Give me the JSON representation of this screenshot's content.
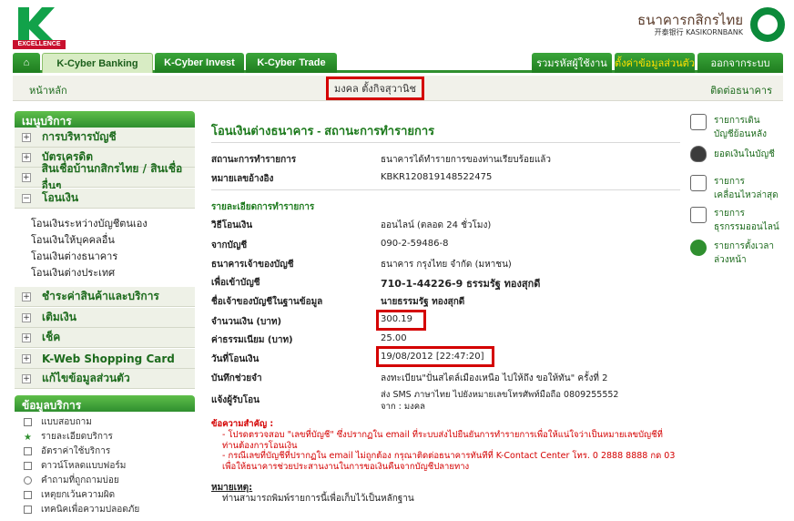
{
  "logo": {
    "brand_letter": "K",
    "excellence": "EXCELLENCE"
  },
  "bank_logo": {
    "thai": "ธนาคารกสิกรไทย",
    "english": "开泰银行 KASIKORNBANK"
  },
  "tabs": {
    "home": "⌂",
    "cyber_banking": "K-Cyber Banking",
    "cyber_invest": "K-Cyber Invest",
    "cyber_trade": "K-Cyber Trade",
    "change_password": "รวมรหัสผู้ใช้งาน",
    "personal_settings": "ตั้งค่าข้อมูลส่วนตัว",
    "logout": "ออกจากระบบ"
  },
  "subbar": {
    "home": "หน้าหลัก",
    "user": "มงคล ตั้งกิจสุวานิช",
    "contact": "ติดต่อธนาคาร"
  },
  "sidebar": {
    "menu_title": "เมนูบริการ",
    "items": [
      {
        "label": "การบริหารบัญชี",
        "toggle": "+"
      },
      {
        "label": "บัตรเครดิต",
        "toggle": "+"
      },
      {
        "label": "สินเชื่อบ้านกสิกรไทย / สินเชื่ออื่นๆ",
        "toggle": "+"
      },
      {
        "label": "โอนเงิน",
        "toggle": "−"
      },
      {
        "label": "ชำระค่าสินค้าและบริการ",
        "toggle": "+"
      },
      {
        "label": "เติมเงิน",
        "toggle": "+"
      },
      {
        "label": "เช็ค",
        "toggle": "+"
      },
      {
        "label": "K-Web Shopping Card",
        "toggle": "+"
      },
      {
        "label": "แก้ไขข้อมูลส่วนตัว",
        "toggle": "+"
      }
    ],
    "transfer_sub": [
      "โอนเงินระหว่างบัญชีตนเอง",
      "โอนเงินให้บุคคลอื่น",
      "โอนเงินต่างธนาคาร",
      "โอนเงินต่างประเทศ"
    ],
    "services_title": "ข้อมูลบริการ",
    "services": [
      "แบบสอบถาม",
      "รายละเอียดบริการ",
      "อัตราค่าใช้บริการ",
      "ดาวน์โหลดแบบฟอร์ม",
      "คำถามที่ถูกถามบ่อย",
      "เหตุยกเว้นความผิด",
      "เทคนิคเพื่อความปลอดภัย"
    ]
  },
  "main": {
    "title": "โอนเงินต่างธนาคาร - สถานะการทำรายการ",
    "status_label": "สถานะการทำรายการ",
    "status_value": "ธนาคารได้ทำรายการของท่านเรียบร้อยแล้ว",
    "ref_label": "หมายเลขอ้างอิง",
    "ref_value": "KBKR120819148522475",
    "details_title": "รายละเอียดการทำรายการ",
    "method_label": "วิธีโอนเงิน",
    "method_value": "ออนไลน์ (ตลอด 24 ชั่วโมง)",
    "from_label": "จากบัญชี",
    "from_value": "090-2-59486-8",
    "bank_label": "ธนาคารเจ้าของบัญชี",
    "bank_value": "ธนาคาร กรุงไทย จำกัด (มหาชน)",
    "to_label": "เพื่อเข้าบัญชี",
    "to_value": "710-1-44226-9 ธรรมรัฐ ทองสุกดี",
    "owner_label": "ชื่อเจ้าของบัญชีในฐานข้อมูล",
    "owner_value": "นายธรรมรัฐ ทองสุกดี",
    "amount_label": "จำนวนเงิน (บาท)",
    "amount_value": "300.19",
    "fee_label": "ค่าธรรมเนียม (บาท)",
    "fee_value": "25.00",
    "date_label": "วันที่โอนเงิน",
    "date_value": "19/08/2012 [22:47:20]",
    "memo_label": "บันทึกช่วยจำ",
    "memo_value": "ลงทะเบียน\"ปั่นสไตล์เมืองเหนือ ไปให้ถึง ขอให้ทัน\" ครั้งที่ 2",
    "notify_label": "แจ้งผู้รับโอน",
    "notify_value": "ส่ง SMS ภาษาไทย ไปยังหมายเลขโทรศัพท์มือถือ 0809255552",
    "notify_from": "จาก : มงคล",
    "caution_title": "ข้อความสำคัญ :",
    "caution1": "- โปรดตรวจสอบ \"เลขที่บัญชี\" ซึ่งปรากฏใน email ที่ระบบส่งไปยืนยันการทำรายการเพื่อให้แน่ใจว่าเป็นหมายเลขบัญชีที่ท่านต้องการโอนเงิน",
    "caution2": "- กรณีเลขที่บัญชีที่ปรากฏใน email ไม่ถูกต้อง กรุณาติดต่อธนาคารทันทีที่ K-Contact Center โทร. 0 2888 8888 กด 03 เพื่อให้ธนาคารช่วยประสานงานในการขอเงินคืนจากบัญชีปลายทาง",
    "remark_title": "หมายเหตุ:",
    "remark": "ท่านสามารถพิมพ์รายการนี้เพื่อเก็บไว้เป็นหลักฐาน"
  },
  "right_panel": [
    {
      "icon": "statement-icon",
      "l1": "รายการเดิน",
      "l2": "บัญชีย้อนหลัง"
    },
    {
      "icon": "money-bag-icon",
      "l1": "ยอดเงินในบัญชี",
      "l2": ""
    },
    {
      "icon": "checklist-icon",
      "l1": "รายการ",
      "l2": "เคลื่อนไหวล่าสุด"
    },
    {
      "icon": "computer-icon",
      "l1": "รายการ",
      "l2": "ธุรกรรมออนไลน์"
    },
    {
      "icon": "clock-icon",
      "l1": "รายการตั้งเวลา",
      "l2": "ล่วงหน้า"
    }
  ]
}
